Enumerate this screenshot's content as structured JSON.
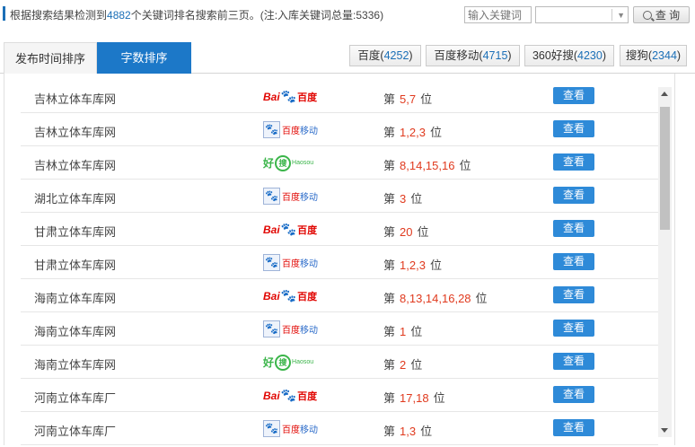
{
  "header": {
    "info_prefix": "根据搜索结果检测到",
    "keyword_count": "4882",
    "info_suffix": "个关键词排名搜索前三页。(注:入库关键词总量:5336)",
    "keyword_placeholder": "输入关键词",
    "search_label": "查 询"
  },
  "tabs": [
    {
      "label": "发布时间排序"
    },
    {
      "label": "字数排序"
    }
  ],
  "engines": [
    {
      "label": "百度",
      "count": "4252"
    },
    {
      "label": "百度移动",
      "count": "4715"
    },
    {
      "label": "360好搜",
      "count": "4230"
    },
    {
      "label": "搜狗",
      "count": "2344"
    }
  ],
  "logo_text": {
    "bai": "Bai",
    "paw": "🐾",
    "du": "百度",
    "mobile_box": "🐾",
    "mobile_a": "百度",
    "mobile_b": "移动",
    "hao": "好",
    "sou": "搜",
    "haosou_en": "Haosou"
  },
  "rank_prefix": "第",
  "rank_suffix": "位",
  "view_label": "查看",
  "rows": [
    {
      "name": "吉林立体车库网",
      "engine": "baidu",
      "rank": "5,7"
    },
    {
      "name": "吉林立体车库网",
      "engine": "baidu-mobile",
      "rank": "1,2,3"
    },
    {
      "name": "吉林立体车库网",
      "engine": "haosou",
      "rank": "8,14,15,16"
    },
    {
      "name": "湖北立体车库网",
      "engine": "baidu-mobile",
      "rank": "3"
    },
    {
      "name": "甘肃立体车库网",
      "engine": "baidu",
      "rank": "20"
    },
    {
      "name": "甘肃立体车库网",
      "engine": "baidu-mobile",
      "rank": "1,2,3"
    },
    {
      "name": "海南立体车库网",
      "engine": "baidu",
      "rank": "8,13,14,16,28"
    },
    {
      "name": "海南立体车库网",
      "engine": "baidu-mobile",
      "rank": "1"
    },
    {
      "name": "海南立体车库网",
      "engine": "haosou",
      "rank": "2"
    },
    {
      "name": "河南立体车库厂",
      "engine": "baidu",
      "rank": "17,18"
    },
    {
      "name": "河南立体车库厂",
      "engine": "baidu-mobile",
      "rank": "1,3"
    }
  ],
  "colors": {
    "accent": "#1c78c8",
    "rank_red": "#e03a1e",
    "view_button": "#2e8ad8"
  }
}
